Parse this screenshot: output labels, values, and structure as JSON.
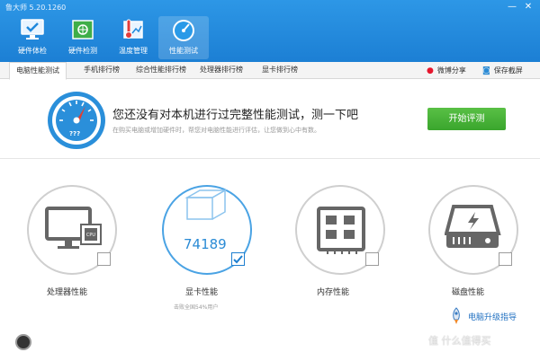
{
  "app": {
    "title": "鲁大师 5.20.1260"
  },
  "window_controls": [
    "minimize-icon",
    "close-icon"
  ],
  "nav": [
    {
      "label": "硬件体检",
      "icon": "monitor-check-icon"
    },
    {
      "label": "硬件检测",
      "icon": "chip-icon"
    },
    {
      "label": "温度管理",
      "icon": "thermometer-icon"
    },
    {
      "label": "性能测试",
      "icon": "speedometer-icon",
      "active": true
    }
  ],
  "tabs": [
    {
      "label": "电脑性能测试",
      "active": true
    },
    {
      "label": "手机排行榜"
    },
    {
      "label": "综合性能排行榜"
    },
    {
      "label": "处理器排行榜"
    },
    {
      "label": "显卡排行榜"
    }
  ],
  "tab_actions": {
    "weibo": "微博分享",
    "screenshot": "保存截屏"
  },
  "banner": {
    "title": "您还没有对本机进行过完整性能测试，测一下吧",
    "subtitle": "在购买电脑或增加硬件时，帮您对电脑性能进行评估，让您做到心中有数。",
    "gauge_text": "???",
    "button": "开始评测"
  },
  "cards": [
    {
      "label": "处理器性能",
      "checked": false,
      "icon": "cpu-monitor-icon"
    },
    {
      "label": "显卡性能",
      "score": "74189",
      "sub": "击败全国54%用户",
      "checked": true,
      "icon": "gpu-cube-icon"
    },
    {
      "label": "内存性能",
      "checked": false,
      "icon": "memory-icon"
    },
    {
      "label": "磁盘性能",
      "checked": false,
      "icon": "disk-icon"
    }
  ],
  "upgrade": {
    "label": "电脑升级指导"
  },
  "watermark": "值 什么值得买",
  "colors": {
    "header": "#1e88dc",
    "accent": "#2b8bd5",
    "button": "#47b136"
  }
}
